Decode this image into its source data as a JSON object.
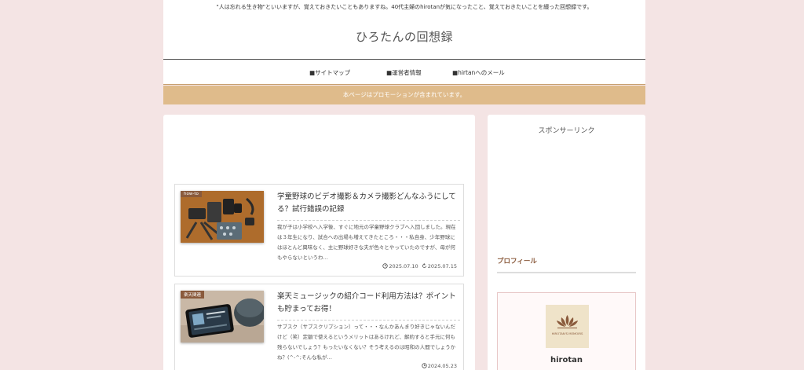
{
  "header": {
    "tagline": "\"人は忘れる生き物\"といいますが、覚えておきたいこともありますね。40代主婦のhirotanが気になったこと、覚えておきたいことを綴った回想録です。",
    "site_title": "ひろたんの回想録"
  },
  "nav": {
    "items": [
      {
        "label": "■サイトマップ"
      },
      {
        "label": "■運営者情報"
      },
      {
        "label": "■hirtanへのメール"
      }
    ]
  },
  "notice": "本ページはプロモーションが含まれています。",
  "posts": [
    {
      "category": "how-to",
      "title": "学童野球のビデオ撮影＆カメラ撮影どんなふうにしてる？試行錯誤の記録",
      "excerpt": "我が子は小学校へ入学後、すぐに地元の学童野球クラブへ入団しました。現在は３年生になり、試合への出場も増えてきたところ・・・私自身、少年野球にはほとんど興味なく、主に野球好きな夫が色々とやっていたのですが、母が何もやらないというわ…",
      "published": "2025.07.10",
      "updated": "2025.07.15"
    },
    {
      "category": "楽天関連",
      "title": "楽天ミュージックの紹介コード利用方法は？ポイントも貯まってお得！",
      "excerpt": "サブスク（サブスクリプション）って・・・なんかあんまり好きじゃないんだけど（笑）定額で使えるというメリットはあるけれど、解約すると手元に何も残らないでしょう？もったいなくない？そう考えるのは昭和の人間でしょうかね？(^-^;そんな私が…",
      "published": "2024.05.23"
    }
  ],
  "sidebar": {
    "sponsor_heading": "スポンサーリンク",
    "profile_heading": "プロフィール",
    "profile_logo_text": "HIROTAN'S MEMOIRS",
    "profile_name": "hirotan"
  }
}
